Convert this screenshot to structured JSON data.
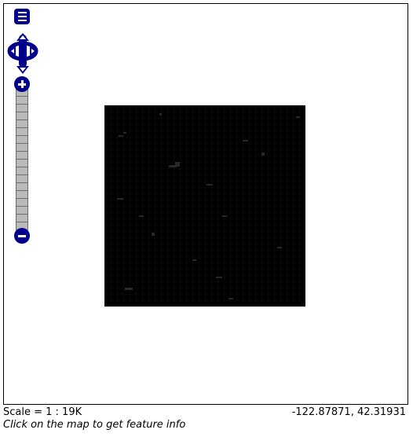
{
  "map": {
    "tile_color": "#000000",
    "background": "#ffffff"
  },
  "controls": {
    "accent_color": "#00008b",
    "layer_switcher_icon": "layer-switcher-icon",
    "pan_icons": [
      "pan-up-icon",
      "pan-left-icon",
      "pan-right-icon",
      "pan-down-icon"
    ],
    "zoom_in_icon": "zoom-in-icon",
    "zoom_out_icon": "zoom-out-icon"
  },
  "status": {
    "scale": "Scale = 1 : 19K",
    "coordinates": "-122.87871, 42.31931",
    "hint": "Click on the map to get feature info"
  }
}
